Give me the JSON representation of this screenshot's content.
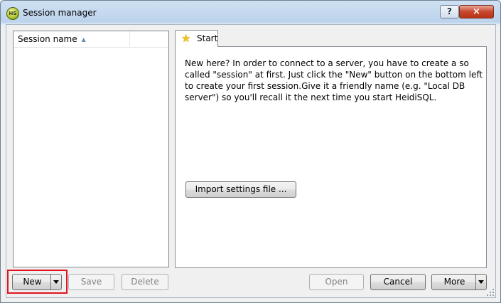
{
  "window": {
    "title": "Session manager",
    "app_icon_text": "HS",
    "help_button": "?",
    "close_button": "×"
  },
  "session_list": {
    "column_header": "Session name",
    "sort_icon": "▲",
    "items": []
  },
  "tabs": [
    {
      "label": "Start",
      "icon": "star-icon"
    }
  ],
  "start_page": {
    "intro_text": "New here? In order to connect to a server, you have to create a so called \"session\" at first. Just click the \"New\" button on the bottom left to create your first session.Give it a friendly name (e.g. \"Local DB server\") so you'll recall it the next time you start HeidiSQL.",
    "import_button": "Import settings file ..."
  },
  "buttons": {
    "new": "New",
    "save": "Save",
    "delete": "Delete",
    "open": "Open",
    "cancel": "Cancel",
    "more": "More"
  },
  "colors": {
    "highlight": "#e0141c",
    "close_button": "#c8472e",
    "star": "#f0c419"
  }
}
